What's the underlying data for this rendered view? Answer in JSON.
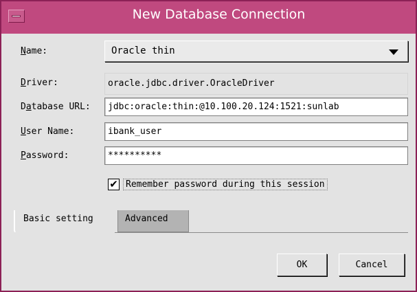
{
  "window": {
    "title": "New Database Connection",
    "menu_button_icon": "window-menu-icon"
  },
  "form": {
    "name": {
      "label_accel": "N",
      "label_rest": "ame:",
      "value": "Oracle thin",
      "dropdown_icon": "chevron-down-icon"
    },
    "driver": {
      "label_accel": "D",
      "label_rest": "river:",
      "value": "oracle.jdbc.driver.OracleDriver"
    },
    "database_url": {
      "label_pre": "D",
      "label_accel": "a",
      "label_rest": "tabase URL:",
      "value": "jdbc:oracle:thin:@10.100.20.124:1521:sunlab"
    },
    "user_name": {
      "label_accel": "U",
      "label_rest": "ser Name:",
      "value": "ibank_user"
    },
    "password": {
      "label_accel": "P",
      "label_rest": "assword:",
      "value": "**********"
    },
    "remember": {
      "checked": true,
      "mark": "✔",
      "label_pre": "R",
      "label_accel": "e",
      "label_rest": "member password during this session"
    }
  },
  "tabs": [
    {
      "label": "Basic setting",
      "active": true
    },
    {
      "label": "Advanced",
      "active": false
    }
  ],
  "buttons": {
    "ok": "OK",
    "cancel": "Cancel"
  },
  "colors": {
    "titlebar": "#c0497f",
    "dialog_background": "#e3e3e3",
    "inactive_tab": "#b3b3b3"
  }
}
